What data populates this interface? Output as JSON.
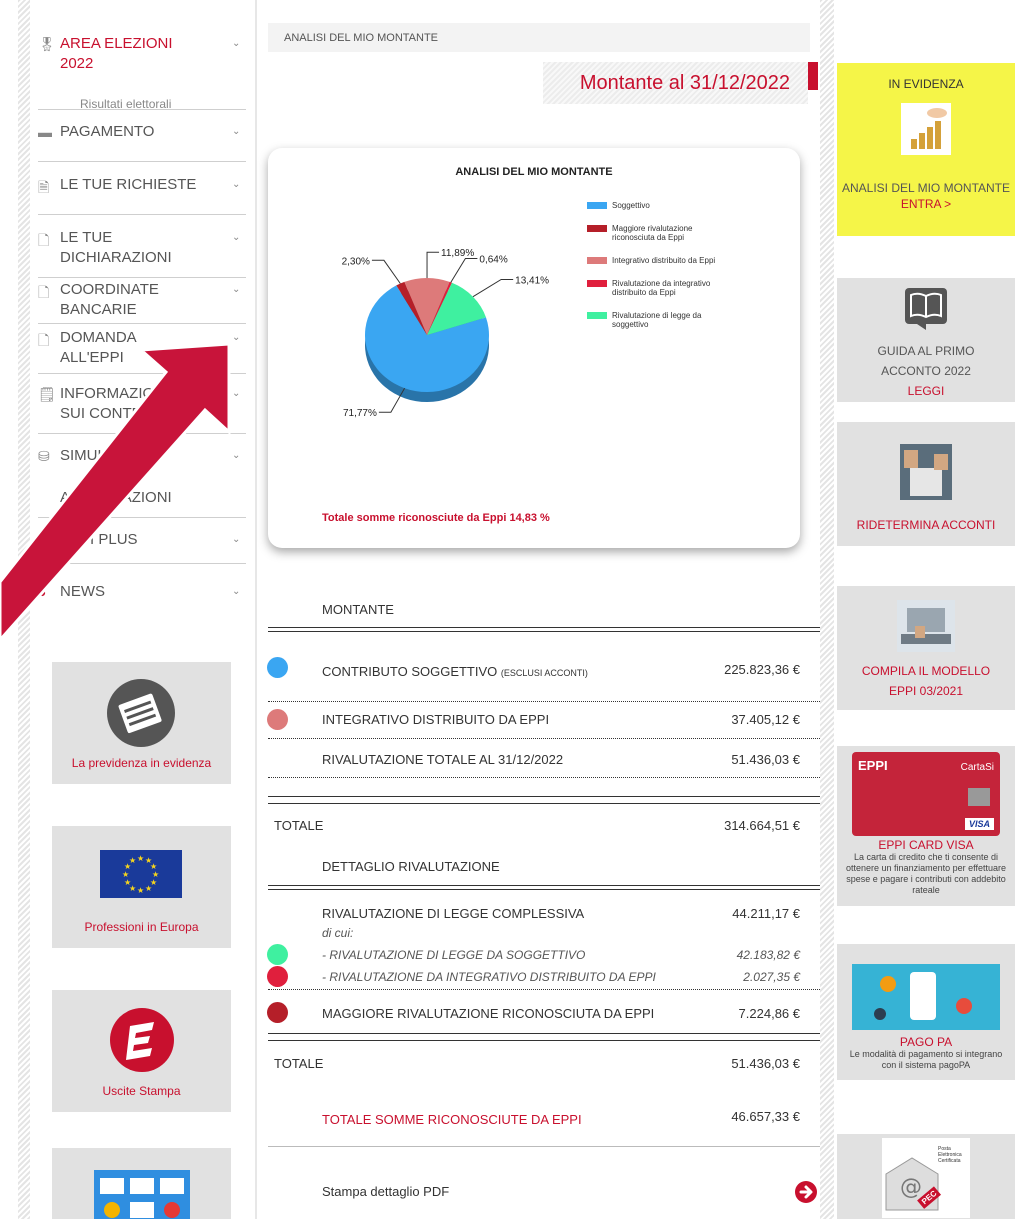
{
  "sidebar": {
    "items": [
      {
        "label": "AREA ELEZIONI 2022",
        "sub": "Risultati elettorali",
        "icon": "award-icon"
      },
      {
        "label": "PAGAMENTO",
        "icon": "credit-card-icon"
      },
      {
        "label": "LE TUE RICHIESTE",
        "icon": "document-icon"
      },
      {
        "label": "LE TUE DICHIARAZIONI",
        "icon": "file-icon"
      },
      {
        "label": "COORDINATE BANCARIE",
        "icon": "file-icon"
      },
      {
        "label": "DOMANDA ALL'EPPI",
        "icon": "file-icon"
      },
      {
        "label": "INFORMAZIONI SUI CONTRIBUTI",
        "icon": "note-icon"
      },
      {
        "label": "SIMULAZIONI",
        "icon": "coins-icon"
      },
      {
        "label": "AGEVOLAZIONI",
        "icon": ""
      },
      {
        "label": "EPPI PLUS",
        "icon": ""
      },
      {
        "label": "NEWS",
        "icon": "chat-icon"
      }
    ],
    "promos": [
      {
        "label": "La previdenza in evidenza"
      },
      {
        "label": "Professioni in Europa"
      },
      {
        "label": "Uscite Stampa"
      },
      {
        "label": ""
      }
    ]
  },
  "breadcrumb": "ANALISI DEL MIO MONTANTE",
  "page_title": "Montante al 31/12/2022",
  "chart_data": {
    "type": "pie",
    "title": "ANALISI DEL MIO MONTANTE",
    "series": [
      {
        "name": "Soggettivo",
        "value": 71.77,
        "label": "71,77%",
        "color": "#3aa6f2"
      },
      {
        "name": "Maggiore rivalutazione riconosciuta da Eppi",
        "value": 2.3,
        "label": "2,30%",
        "color": "#b51f29"
      },
      {
        "name": "Integrativo distribuito da Eppi",
        "value": 11.89,
        "label": "11,89%",
        "color": "#dd7a7a"
      },
      {
        "name": "Rivalutazione da integrativo distribuito da Eppi",
        "value": 0.64,
        "label": "0,64%",
        "color": "#e01f3d"
      },
      {
        "name": "Rivalutazione di legge da soggettivo",
        "value": 13.41,
        "label": "13,41%",
        "color": "#3ff0a0"
      }
    ],
    "footer": "Totale somme riconosciute da Eppi 14,83 %",
    "legend_position": "right"
  },
  "table": {
    "montante_header": "MONTANTE",
    "contributo_label": "CONTRIBUTO SOGGETTIVO",
    "contributo_note": "(ESCLUSI ACCONTI)",
    "contributo_value": "225.823,36 €",
    "integrativo_label": "INTEGRATIVO DISTRIBUITO DA EPPI",
    "integrativo_value": "37.405,12 €",
    "rivalutazione_label": "RIVALUTAZIONE TOTALE AL 31/12/2022",
    "rivalutazione_value": "51.436,03 €",
    "totale1_label": "TOTALE",
    "totale1_value": "314.664,51 €",
    "dettaglio_header": "DETTAGLIO RIVALUTAZIONE",
    "legge_label": "RIVALUTAZIONE DI LEGGE COMPLESSIVA",
    "legge_value": "44.211,17 €",
    "dicui": "di cui:",
    "da_sogg_label": "- RIVALUTAZIONE DI LEGGE DA SOGGETTIVO",
    "da_sogg_value": "42.183,82 €",
    "da_integr_label": "- RIVALUTAZIONE DA INTEGRATIVO DISTRIBUITO DA EPPI",
    "da_integr_value": "2.027,35 €",
    "maggiore_label": "MAGGIORE RIVALUTAZIONE RICONOSCIUTA DA EPPI",
    "maggiore_value": "7.224,86 €",
    "totale2_label": "TOTALE",
    "totale2_value": "51.436,03 €",
    "somme_label": "TOTALE SOMME RICONOSCIUTE DA EPPI",
    "somme_value": "46.657,33 €",
    "stampa_label": "Stampa dettaglio PDF"
  },
  "right": {
    "evidenza_title": "IN EVIDENZA",
    "evidenza_label": "ANALISI DEL MIO MONTANTE",
    "evidenza_link": "ENTRA >",
    "guida_label1": "GUIDA AL PRIMO",
    "guida_label2": "ACCONTO 2022",
    "guida_link": "LEGGI",
    "ridetermina_label": "RIDETERMINA ACCONTI",
    "compila_label1": "COMPILA IL MODELLO",
    "compila_label2": "EPPI 03/2021",
    "card_label": "EPPI CARD VISA",
    "card_brand": "EPPI",
    "card_cartasi": "CartaSi",
    "card_visa": "VISA",
    "card_desc": "La carta di credito che ti consente di ottenere un finanziamento per effettuare spese e pagare i contributi con addebito rateale",
    "pagopa_label": "PAGO PA",
    "pagopa_desc": "Le modalità di pagamento si integrano con il sistema pagoPA",
    "pec_text": "Posta Elettronica Certificata",
    "pec_badge": "PEC"
  }
}
